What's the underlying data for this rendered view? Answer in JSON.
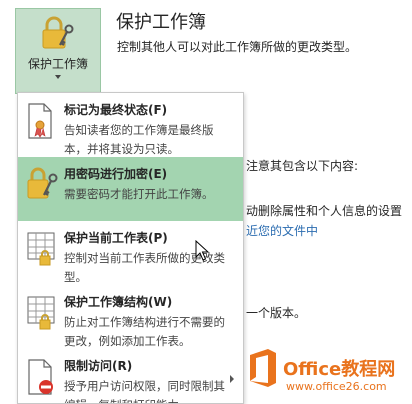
{
  "protect_button": {
    "label": "保护工作簿"
  },
  "header": {
    "title": "保护工作簿",
    "description": "控制其他人可以对此工作簿所做的更改类型。"
  },
  "background": {
    "line1": "注意其包含以下内容:",
    "line2": "动删除属性和个人信息的设置",
    "line3": "近您的文件中",
    "line4": "一个版本。"
  },
  "menu": {
    "items": [
      {
        "title": "标记为最终状态(F)",
        "desc": "告知读者您的工作簿是最终版本，并将其设为只读。",
        "icon": "document-ribbon-icon"
      },
      {
        "title": "用密码进行加密(E)",
        "desc": "需要密码才能打开此工作簿。",
        "icon": "lock-key-icon"
      },
      {
        "title": "保护当前工作表(P)",
        "desc": "控制对当前工作表所做的更改类型。",
        "icon": "sheet-lock-icon"
      },
      {
        "title": "保护工作簿结构(W)",
        "desc": "防止对工作簿结构进行不需要的更改，例如添加工作表。",
        "icon": "workbook-structure-icon"
      },
      {
        "title": "限制访问(R)",
        "desc": "授予用户访问权限，同时限制其编辑、复制和打印能力。",
        "icon": "restrict-access-icon"
      }
    ]
  },
  "watermark": {
    "brand": "Office教程网",
    "url": "www.office26.com"
  },
  "colors": {
    "highlight": "#a3d4b0",
    "button_bg": "#c5dfcb",
    "logo": "#e9731d",
    "link": "#2b6cb0"
  }
}
